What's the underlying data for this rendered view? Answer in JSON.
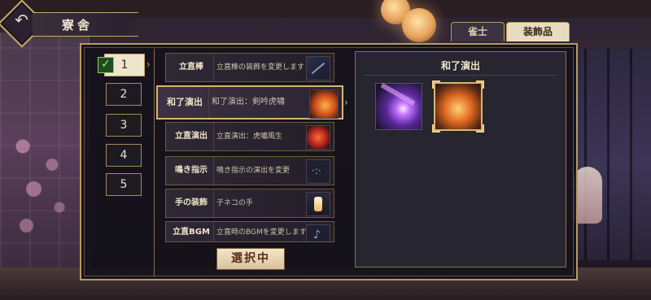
{
  "header": {
    "title": "寮舎",
    "back_icon": "back-arrow-icon"
  },
  "tabs": [
    {
      "label": "雀士",
      "active": false
    },
    {
      "label": "装飾品",
      "active": true
    }
  ],
  "slots": [
    {
      "label": "1",
      "active": true,
      "checked": true
    },
    {
      "label": "2",
      "active": false
    },
    {
      "label": "3",
      "active": false
    },
    {
      "label": "4",
      "active": false
    },
    {
      "label": "5",
      "active": false
    }
  ],
  "items": [
    {
      "name": "立直棒",
      "desc": "立直棒の装飾を変更します",
      "icon": "riichi-stick-icon"
    },
    {
      "name": "和了演出",
      "desc": "和了演出：剣吟虎嘯",
      "icon": "tiger-flame-icon",
      "selected": true
    },
    {
      "name": "立直演出",
      "desc": "立直演出：虎嘯風生",
      "icon": "tiger-roar-icon"
    },
    {
      "name": "鳴き指示",
      "desc": "鳴き指示の演出を変更",
      "icon": "call-indicator-icon"
    },
    {
      "name": "手の装飾",
      "desc": "子ネコの手",
      "icon": "kitten-paw-icon"
    },
    {
      "name": "立直BGM",
      "desc": "立直時のBGMを変更します",
      "icon": "music-note-icon"
    }
  ],
  "select_button": {
    "label": "選択中"
  },
  "detail": {
    "title": "和了演出",
    "options": [
      {
        "icon": "purple-beam-icon",
        "selected": false
      },
      {
        "icon": "tiger-flame-icon",
        "selected": true
      }
    ]
  },
  "colors": {
    "accent_gold": "#b89a62",
    "panel_bg": "#262530",
    "tab_active_bg": "#e8dcc0"
  }
}
